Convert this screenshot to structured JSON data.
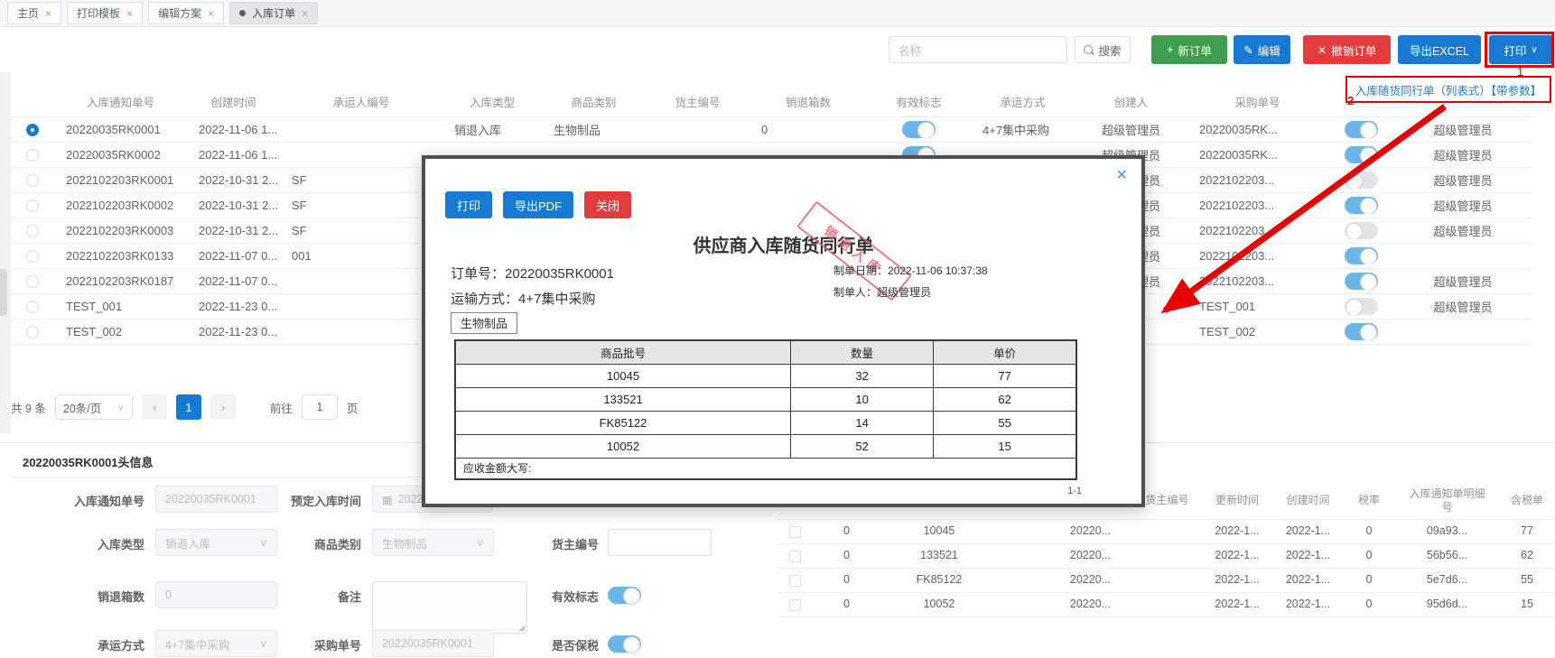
{
  "icons": {
    "plus": "+",
    "edit": "✎",
    "delete": "✕",
    "chevron_down": "∨",
    "close": "×",
    "prev": "‹",
    "next": "›",
    "calendar": "▦"
  },
  "colors": {
    "primary_blue": "#1779d2",
    "success_green": "#3f9e4d",
    "danger_red": "#e23c3c",
    "toggle_on": "#6cb5e6",
    "annotation_red": "#e60000"
  },
  "tabs": [
    {
      "label": "主页"
    },
    {
      "label": "打印模板"
    },
    {
      "label": "编辑方案"
    },
    {
      "label": "入库订单",
      "active": true
    }
  ],
  "toolbar": {
    "search_placeholder": "名称",
    "search": "搜索",
    "new_order": "新订单",
    "edit": "编辑",
    "cancel": "撤销订单",
    "export_excel": "导出EXCEL",
    "print": "打印"
  },
  "annotation": {
    "step1": "1",
    "step2": "2",
    "print_option": "入库随货同行单（列表式）【带参数】"
  },
  "orders": {
    "headers": [
      "",
      "入库通知单号",
      "创建时间",
      "承运人编号",
      "入库类型",
      "商品类别",
      "货主编号",
      "销退箱数",
      "有效标志",
      "承运方式",
      "创建人",
      "采购单号",
      "",
      ""
    ],
    "rows": [
      {
        "radio": "sel",
        "notify": "20220035RK0001",
        "time": "2022-11-06 1...",
        "carrier": "",
        "type": "销退入库",
        "cat": "生物制品",
        "owner": "",
        "boxes": "0",
        "valid": "on",
        "trans": "4+7集中采购",
        "creator": "超级管理员",
        "purch": "20220035RK...",
        "flag2": "on",
        "upd": "超级管理员"
      },
      {
        "radio": "un",
        "notify": "20220035RK0002",
        "time": "2022-11-06 1...",
        "carrier": "",
        "type": "",
        "cat": "",
        "owner": "",
        "boxes": "",
        "valid": "on",
        "trans": "",
        "creator": "超级管理员",
        "purch": "20220035RK...",
        "flag2": "on",
        "upd": "超级管理员"
      },
      {
        "radio": "un",
        "notify": "2022102203RK0001",
        "time": "2022-10-31 2...",
        "carrier": "SF",
        "type": "",
        "cat": "",
        "owner": "",
        "boxes": "",
        "valid": "none",
        "trans": "",
        "creator": "超级管理员",
        "purch": "2022102203...",
        "flag2": "off",
        "upd": "超级管理员"
      },
      {
        "radio": "un",
        "notify": "2022102203RK0002",
        "time": "2022-10-31 2...",
        "carrier": "SF",
        "type": "",
        "cat": "",
        "owner": "",
        "boxes": "",
        "valid": "none",
        "trans": "",
        "creator": "超级管理员",
        "purch": "2022102203...",
        "flag2": "on",
        "upd": "超级管理员"
      },
      {
        "radio": "un",
        "notify": "2022102203RK0003",
        "time": "2022-10-31 2...",
        "carrier": "SF",
        "type": "",
        "cat": "",
        "owner": "",
        "boxes": "",
        "valid": "none",
        "trans": "",
        "creator": "超级管理员",
        "purch": "2022102203...",
        "flag2": "off",
        "upd": "超级管理员"
      },
      {
        "radio": "un",
        "notify": "2022102203RK0133",
        "time": "2022-11-07 0...",
        "carrier": "001",
        "type": "",
        "cat": "",
        "owner": "",
        "boxes": "",
        "valid": "none",
        "trans": "",
        "creator": "超级管理员",
        "purch": "2022102203...",
        "flag2": "on",
        "upd": ""
      },
      {
        "radio": "un",
        "notify": "2022102203RK0187",
        "time": "2022-11-07 0...",
        "carrier": "",
        "type": "",
        "cat": "",
        "owner": "",
        "boxes": "",
        "valid": "none",
        "trans": "",
        "creator": "超级管理员",
        "purch": "2022102203...",
        "flag2": "on",
        "upd": "超级管理员"
      },
      {
        "radio": "un",
        "notify": "TEST_001",
        "time": "2022-11-23 0...",
        "carrier": "",
        "type": "",
        "cat": "",
        "owner": "",
        "boxes": "",
        "valid": "none",
        "trans": "",
        "creator": "",
        "purch": "TEST_001",
        "flag2": "off",
        "upd": "超级管理员"
      },
      {
        "radio": "un",
        "notify": "TEST_002",
        "time": "2022-11-23 0...",
        "carrier": "",
        "type": "",
        "cat": "",
        "owner": "",
        "boxes": "",
        "valid": "none",
        "trans": "",
        "creator": "",
        "purch": "TEST_002",
        "flag2": "on",
        "upd": ""
      }
    ]
  },
  "pagination": {
    "total": "共 9 条",
    "page_size": "20条/页",
    "page": "1",
    "goto_label": "前往",
    "goto_value": "1",
    "goto_unit": "页"
  },
  "modal": {
    "print": "打印",
    "export_pdf": "导出PDF",
    "close_btn": "关闭",
    "title": "供应商入库随货同行单",
    "order_label": "订单号：",
    "order_no": "20220035RK0001",
    "transport_label": "运输方式：",
    "transport": "4+7集中采购",
    "date_label": "制单日期：",
    "date": "2022-11-06 10:37:38",
    "maker_label": "制单人：",
    "maker": "超级管理员",
    "stamp": "销退入库",
    "category": "生物制品",
    "amount_label": "应收金额大写:",
    "page_indicator": "1-1",
    "table": {
      "headers": [
        "商品批号",
        "数量",
        "单价"
      ],
      "rows": [
        [
          "10045",
          "32",
          "77"
        ],
        [
          "133521",
          "10",
          "62"
        ],
        [
          "FK85122",
          "14",
          "55"
        ],
        [
          "10052",
          "52",
          "15"
        ]
      ]
    }
  },
  "header_info": {
    "title": "20220035RK0001头信息",
    "notify_no": {
      "label": "入库通知单号",
      "value": "20220035RK0001"
    },
    "planned_time": {
      "label": "预定入库时间",
      "value": "2022-"
    },
    "in_type": {
      "label": "入库类型",
      "value": "销退入库"
    },
    "category": {
      "label": "商品类别",
      "value": "生物制品"
    },
    "owner_no": {
      "label": "货主编号",
      "value": ""
    },
    "return_boxes": {
      "label": "销退箱数",
      "value": "0"
    },
    "remark": {
      "label": "备注",
      "value": ""
    },
    "valid_flag": {
      "label": "有效标志"
    },
    "transport": {
      "label": "承运方式",
      "value": "4+7集中采购"
    },
    "purchase_no": {
      "label": "采购单号",
      "value": "20220035RK0001"
    },
    "bonded": {
      "label": "是否保税"
    }
  },
  "details": {
    "headers": [
      "",
      "",
      "",
      "",
      "",
      "货主编号",
      "更新时间",
      "创建时间",
      "税率",
      "入库通知单明细号",
      "含税单"
    ],
    "rows": [
      {
        "c2": "0",
        "c3": "10045",
        "c4": "",
        "c5": "20220...",
        "c6": "",
        "c7": "2022-1...",
        "c8": "2022-1...",
        "c9": "0",
        "c10": "09a93...",
        "c11": "77"
      },
      {
        "c2": "0",
        "c3": "133521",
        "c4": "",
        "c5": "20220...",
        "c6": "",
        "c7": "2022-1...",
        "c8": "2022-1...",
        "c9": "0",
        "c10": "56b56...",
        "c11": "62"
      },
      {
        "c2": "0",
        "c3": "FK85122",
        "c4": "",
        "c5": "20220...",
        "c6": "",
        "c7": "2022-1...",
        "c8": "2022-1...",
        "c9": "0",
        "c10": "5e7d6...",
        "c11": "55"
      },
      {
        "c2": "0",
        "c3": "10052",
        "c4": "",
        "c5": "20220...",
        "c6": "",
        "c7": "2022-1...",
        "c8": "2022-1...",
        "c9": "0",
        "c10": "95d6d...",
        "c11": "15"
      }
    ]
  }
}
